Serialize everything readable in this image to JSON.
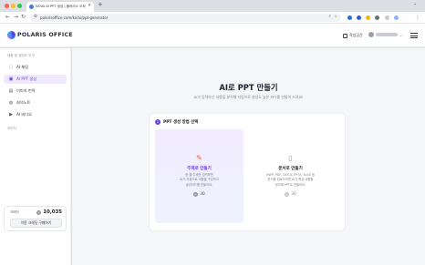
{
  "browser": {
    "tab_title": "NOVA AI PPT 생성 | 폴라리스 오피스",
    "tab_close": "✕",
    "new_tab": "+",
    "url": "polarisoffice.com/ko/ai/ppt-generator",
    "window_min": "⌄",
    "traffic_colors": [
      "#ff5f57",
      "#febc2e",
      "#28c840"
    ]
  },
  "header": {
    "logo_text": "POLARIS OFFICE",
    "action_label": "작업공간",
    "menu_icon": "hamburger-menu-icon"
  },
  "sidebar": {
    "section1_label": "제품 및 생성도 도구",
    "items": [
      {
        "label": "AI 채팅",
        "icon": "chat-icon"
      },
      {
        "label": "AI PPT 생성",
        "icon": "presentation-icon"
      },
      {
        "label": "이미지 번역",
        "icon": "image-translate-icon"
      },
      {
        "label": "회의노트",
        "icon": "meeting-note-icon"
      },
      {
        "label": "AI 비디오",
        "icon": "video-icon"
      }
    ],
    "section2_label": "이미지",
    "credit_label": "크레딧",
    "credit_value": "10,035",
    "buy_label": "이용 크레딧 구매하기"
  },
  "main": {
    "title": "AI로 PPT 만들기",
    "subtitle": "AI가 입력하신 내용을 분석해 자동으로 완성도 높은 PPT를 만들어 드려요!",
    "step_number": "1",
    "step_label": "PPT 생성 방법 선택",
    "options": [
      {
        "title": "주제로 만들기",
        "desc": [
          "한 줄 주제만 입력하면",
          "AI가 자동으로 내용을 구성하고",
          "슬라이드를 만들어요."
        ],
        "cost": "30",
        "selected": true,
        "icon": "pencil-icon"
      },
      {
        "title": "문서로 만들기",
        "desc": [
          "HWP, PDF, DOCX, PPTX, XLSX 등",
          "문서를 업로드하면 AI가 핵심 내용을",
          "정리해 PPT로 만들어요."
        ],
        "cost": "30",
        "selected": false,
        "icon": "document-icon"
      }
    ]
  },
  "colors": {
    "accent": "#6a3fe0",
    "selected_bg": "#f1ecfe"
  }
}
